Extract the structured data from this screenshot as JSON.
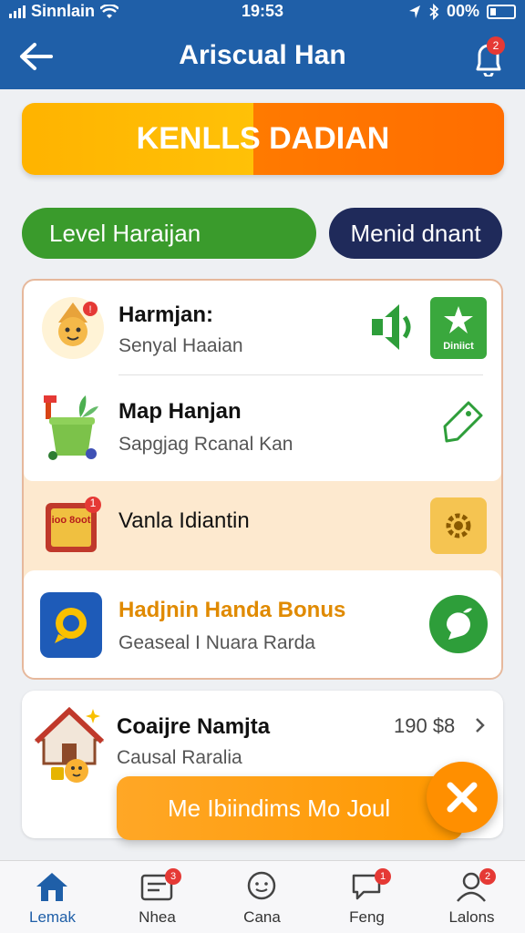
{
  "status": {
    "carrier": "Sinnlain",
    "time": "19:53",
    "battery": "00%"
  },
  "header": {
    "title": "Ariscual Han",
    "bell_badge": "2"
  },
  "banner": {
    "text": "KENLLS DADIAN"
  },
  "pills": {
    "left": "Level Haraijan",
    "right": "Menid dnant"
  },
  "items": [
    {
      "title": "Harmjan:",
      "subtitle": "Senyal Haaian",
      "action_label": "Diniict"
    },
    {
      "title": "Map Hanjan",
      "subtitle": "Sapgjag Rcanal Kan"
    },
    {
      "title": "Vanla Idiantin",
      "icon_text": "ioo 8oot",
      "icon_badge": "1"
    },
    {
      "title": "Hadjnin Handa Bonus",
      "subtitle": "Geaseal I Nuara Rarda"
    },
    {
      "title": "Coaijre Namjta",
      "subtitle": "Causal Raralia",
      "value": "190 $8"
    }
  ],
  "toast": {
    "text": "Me Ibiindims Mo Joul"
  },
  "nav": [
    {
      "label": "Lemak",
      "icon": "home-icon"
    },
    {
      "label": "Nhea",
      "icon": "mail-icon",
      "badge": "3"
    },
    {
      "label": "Cana",
      "icon": "chat-icon"
    },
    {
      "label": "Feng",
      "icon": "speech-icon",
      "badge": "1"
    },
    {
      "label": "Lalons",
      "icon": "user-icon",
      "badge": "2"
    }
  ],
  "colors": {
    "header": "#1f5fa8",
    "orange": "#ff8f00",
    "green": "#3a9b2c",
    "navy": "#1f2a5a",
    "accent_text": "#e08a00"
  }
}
